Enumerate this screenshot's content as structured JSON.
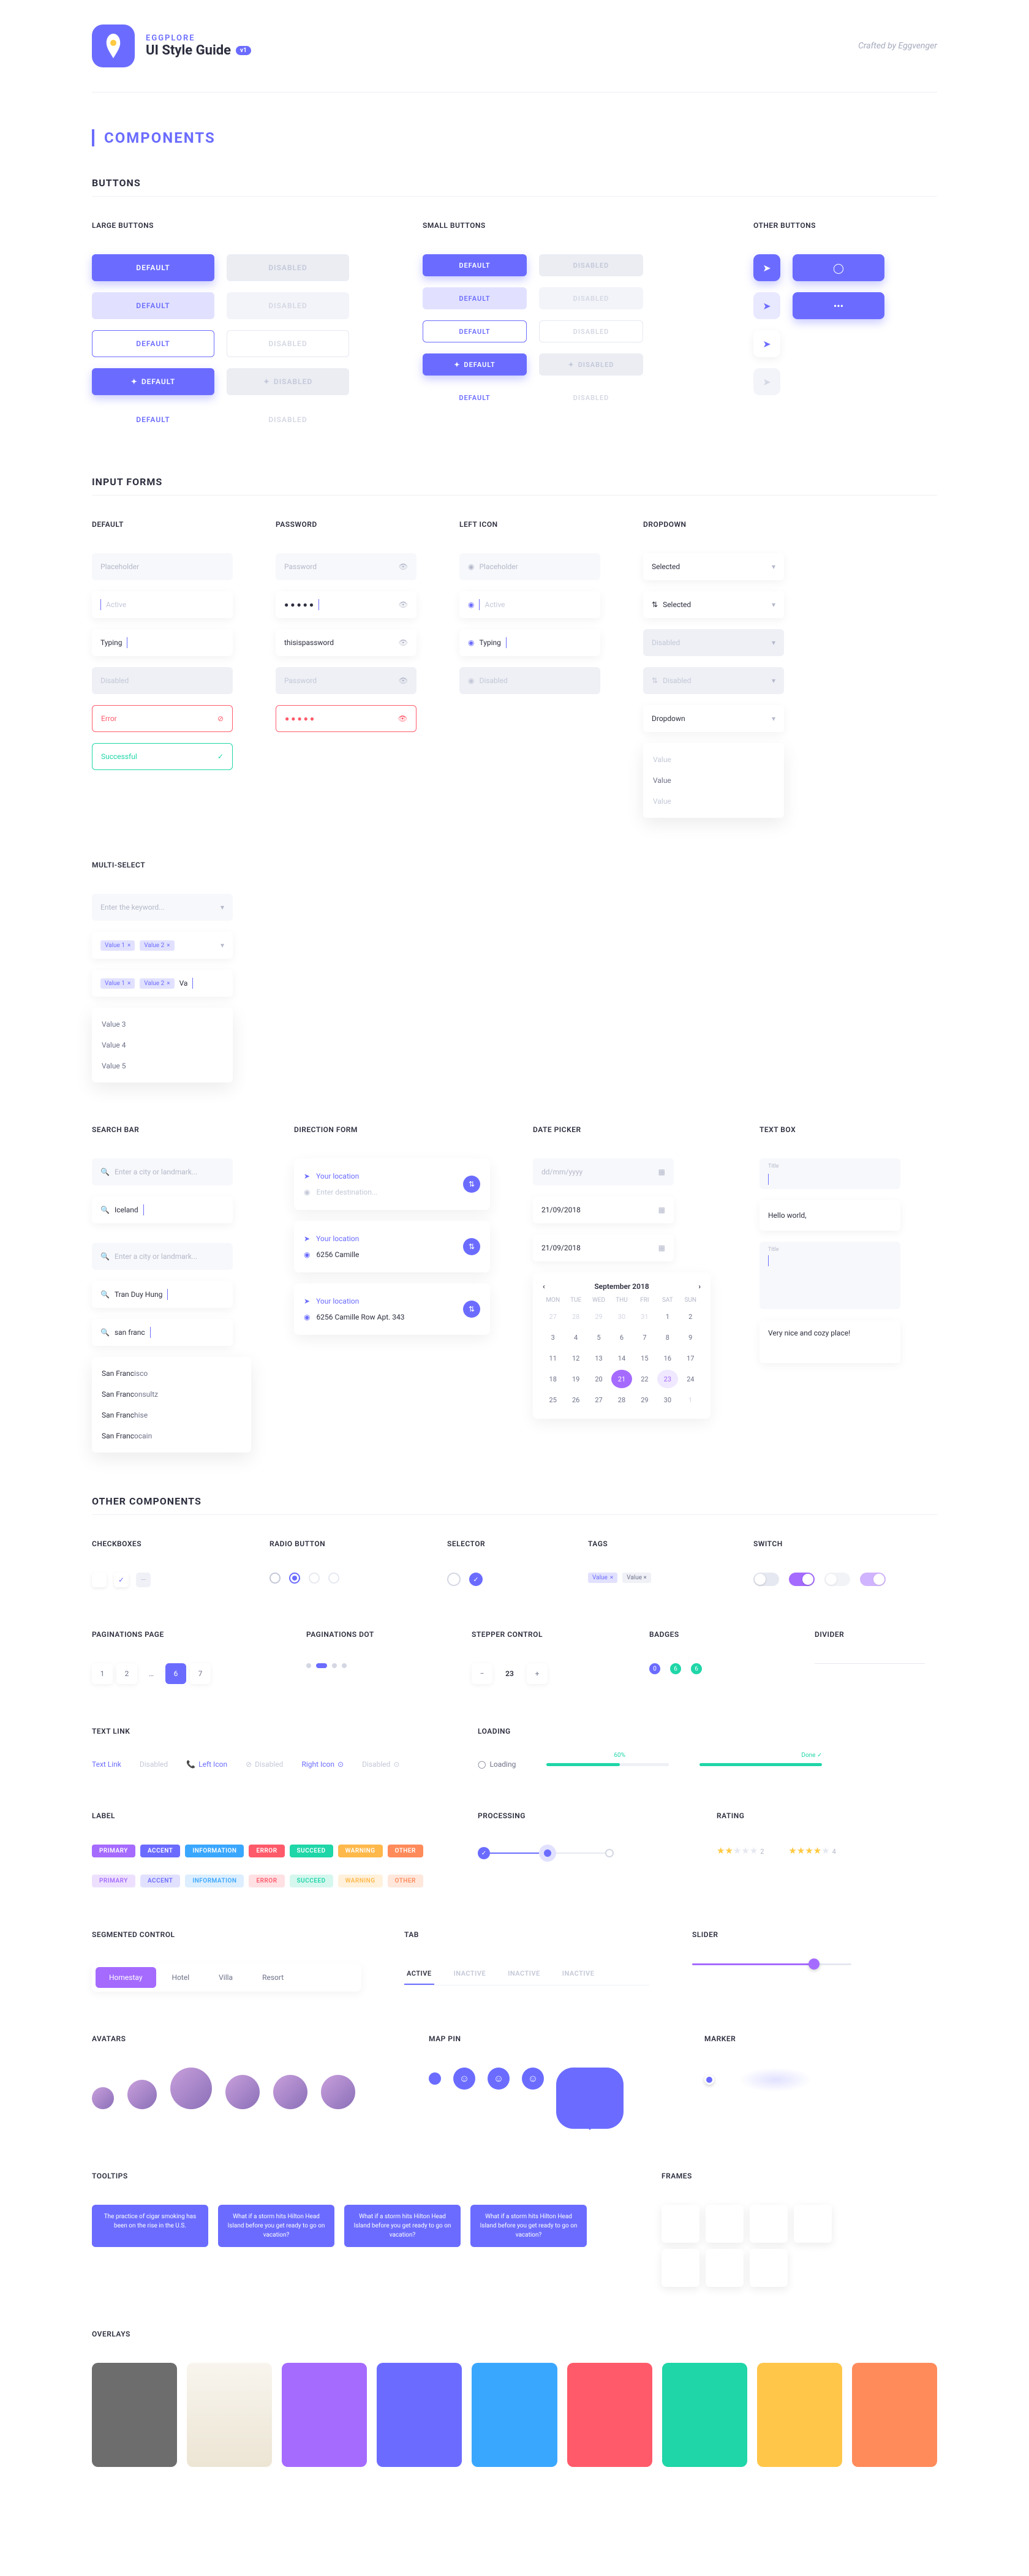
{
  "brand": {
    "name": "EGGPLORE",
    "title": "UI Style Guide",
    "version": "v1",
    "crafted": "Crafted by Eggvenger"
  },
  "section": "COMPONENTS",
  "buttons": {
    "title": "BUTTONS",
    "large": "LARGE BUTTONS",
    "small": "SMALL BUTTONS",
    "other": "OTHER BUTTONS",
    "default": "DEFAULT",
    "disabled": "DISABLED"
  },
  "inputs": {
    "title": "INPUT FORMS",
    "default": "DEFAULT",
    "password": "PASSWORD",
    "lefticon": "LEFT ICON",
    "dropdown": "DROPDOWN",
    "multi": "MULTI-SELECT",
    "ph": "Placeholder",
    "active": "Active",
    "typing": "Typing",
    "dis": "Disabled",
    "err": "Error",
    "ok": "Successful",
    "pw_ph": "Password",
    "pw_typing": "thisispassword",
    "dd_sel": "Selected",
    "dd_dis": "Disabled",
    "dd_label": "Dropdown",
    "dd_val": "Value",
    "ms_ph": "Enter the keyword...",
    "ms_v1": "Value 1",
    "ms_v2": "Value 2",
    "ms_va": "Va",
    "ms_v3": "Value 3",
    "ms_v4": "Value 4",
    "ms_v5": "Value 5"
  },
  "search": {
    "title": "SEARCH BAR",
    "ph": "Enter a city or landmark...",
    "v1": "Iceland",
    "v2": "Tran Duy Hung",
    "v3": "san franc",
    "s1": "San Franc",
    "s1b": "isco",
    "s2": "San Franc",
    "s2b": "onsultz",
    "s3": "San Franc",
    "s3b": "hise",
    "s4": "San Franc",
    "s4b": "ocain"
  },
  "direction": {
    "title": "DIRECTION FORM",
    "yl": "Your location",
    "ed": "Enter destination...",
    "d1": "6256 Camille",
    "d2": "6256 Camille Row Apt. 343"
  },
  "date": {
    "title": "DATE PICKER",
    "ph": "dd/mm/yyyy",
    "val": "21/09/2018",
    "month": "September 2018",
    "days": [
      "MON",
      "TUE",
      "WED",
      "THU",
      "FRI",
      "SAT",
      "SUN"
    ]
  },
  "text": {
    "title": "TEXT BOX",
    "lbl": "Title",
    "v1": "Hello world,",
    "v2": "Very nice and cozy place!"
  },
  "other": {
    "title": "OTHER COMPONENTS",
    "check": "CHECKBOXES",
    "radio": "RADIO BUTTON",
    "selector": "SELECTOR",
    "tags": "TAGS",
    "switch": "SWITCH",
    "tag_v": "Value",
    "pag_page": "PAGINATIONS PAGE",
    "pag_dot": "PAGINATIONS DOT",
    "stepper": "STEPPER CONTROL",
    "step_v": "23",
    "badges": "BADGES",
    "divider": "DIVIDER",
    "tlink": "TEXT LINK",
    "tl1": "Text Link",
    "tl2": "Disabled",
    "tl3": "Left Icon",
    "tl4": "Disabled",
    "tl5": "Right Icon",
    "tl6": "Disabled",
    "loading": "LOADING",
    "loading_t": "Loading",
    "p60": "60%",
    "done": "Done",
    "label": "LABEL",
    "labels": [
      "PRIMARY",
      "ACCENT",
      "INFORMATION",
      "ERROR",
      "SUCCEED",
      "WARNING",
      "OTHER"
    ],
    "processing": "PROCESSING",
    "rating": "RATING",
    "r2": "2",
    "r4": "4",
    "seg": "SEGMENTED CONTROL",
    "segs": [
      "Homestay",
      "Hotel",
      "Villa",
      "Resort"
    ],
    "tab": "TAB",
    "tabs": [
      "ACTIVE",
      "INACTIVE",
      "INACTIVE",
      "INACTIVE"
    ],
    "slider": "SLIDER",
    "avatars": "AVATARS",
    "mappin": "MAP PIN",
    "marker": "MARKER",
    "tooltips": "TOOLTIPS",
    "tip1": "The practice of cigar smoking has been on the rise in the U.S.",
    "tip2": "What if a storm hits Hilton Head Island before you get ready to go on vacation?",
    "frames": "FRAMES",
    "overlays": "OVERLAYS"
  }
}
